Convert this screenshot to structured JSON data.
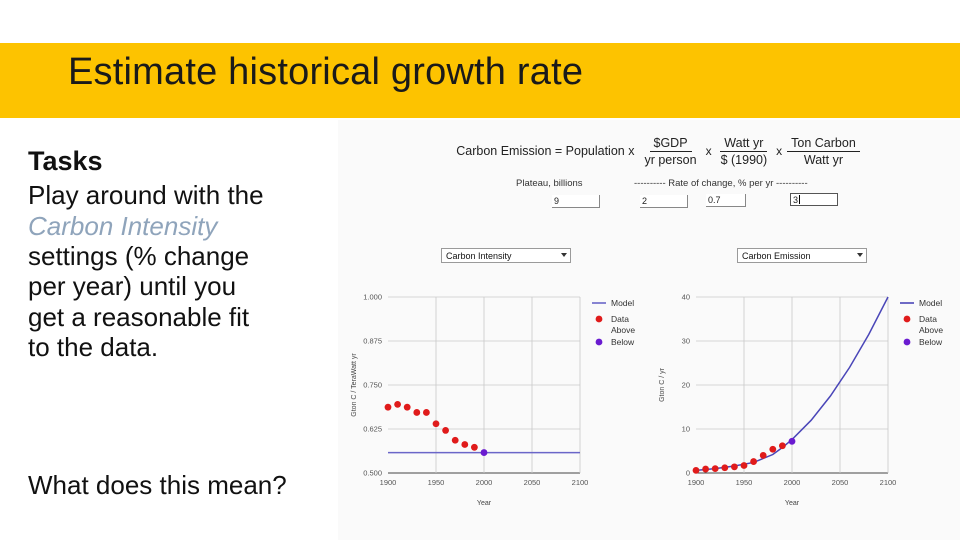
{
  "slide": {
    "title": "Estimate historical growth rate",
    "banner_color": "#fdc300"
  },
  "tasks": {
    "heading": "Tasks",
    "lines": [
      {
        "text": "Play around with the",
        "style": "normal"
      },
      {
        "text": "Carbon Intensity",
        "style": "italic-accent"
      },
      {
        "text": "settings (% change",
        "style": "normal"
      },
      {
        "text": "per year) until you",
        "style": "normal"
      },
      {
        "text": "get a reasonable fit",
        "style": "normal"
      },
      {
        "text": "to the data.",
        "style": "normal"
      }
    ],
    "question": "What does this mean?",
    "accent_color": "#8fa4bb"
  },
  "app": {
    "equation": {
      "lhs": "Carbon Emission = Population x",
      "times": "x",
      "terms": [
        {
          "numerator": "$GDP",
          "denominator": "yr  person"
        },
        {
          "numerator": "Watt yr",
          "denominator": "$ (1990)"
        },
        {
          "numerator": "Ton Carbon",
          "denominator": "Watt yr"
        }
      ]
    },
    "params": {
      "plateau_label": "Plateau, billions",
      "plateau_value": "9",
      "rate_label": "---------- Rate of change, % per yr ----------",
      "rate_population": "2",
      "rate_gdp": "0.7",
      "rate_intensity": "3"
    },
    "dropdowns": [
      {
        "name": "carbon-intensity-select",
        "value": "Carbon Intensity"
      },
      {
        "name": "carbon-emission-select",
        "value": "Carbon Emission"
      }
    ]
  },
  "chart_data": [
    {
      "type": "scatter",
      "id": "carbon-intensity",
      "title": "Carbon Intensity",
      "xlabel": "Year",
      "ylabel": "Gton C / TeraWatt yr",
      "xlim": [
        1900,
        2100
      ],
      "ylim": [
        0.5,
        1.0
      ],
      "xticks": [
        1900,
        1950,
        2000,
        2050,
        2100
      ],
      "yticks": [
        "0.500",
        "0.625",
        "0.750",
        "0.875",
        "1.000"
      ],
      "grid": true,
      "legend": [
        "Model",
        "Data",
        "Above",
        "Below"
      ],
      "legend_position": "right",
      "series": [
        {
          "name": "Model",
          "kind": "line",
          "color": "#6a66c8",
          "x": [
            1900,
            1950,
            2000,
            2050,
            2100
          ],
          "values": [
            0.558,
            0.558,
            0.558,
            0.558,
            0.558
          ]
        },
        {
          "name": "Data",
          "kind": "points",
          "color": "#e01b1b",
          "x": [
            1900,
            1910,
            1920,
            1930,
            1940,
            1950,
            1960,
            1970,
            1980,
            1990
          ],
          "values": [
            0.687,
            0.695,
            0.687,
            0.672,
            0.672,
            0.64,
            0.621,
            0.593,
            0.581,
            0.573
          ]
        },
        {
          "name": "Below",
          "kind": "points",
          "color": "#6a1bd0",
          "x": [
            2000
          ],
          "values": [
            0.558
          ]
        }
      ]
    },
    {
      "type": "line",
      "id": "carbon-emission",
      "title": "Carbon Emission",
      "xlabel": "Year",
      "ylabel": "Gton C / yr",
      "xlim": [
        1900,
        2100
      ],
      "ylim": [
        0,
        40
      ],
      "xticks": [
        1900,
        1950,
        2000,
        2050,
        2100
      ],
      "yticks": [
        "0",
        "10",
        "20",
        "30",
        "40"
      ],
      "grid": true,
      "legend": [
        "Model",
        "Data",
        "Above",
        "Below"
      ],
      "legend_position": "right",
      "series": [
        {
          "name": "Model",
          "kind": "line",
          "color": "#4a46b8",
          "x": [
            1900,
            1920,
            1940,
            1960,
            1980,
            1990,
            2000,
            2020,
            2040,
            2060,
            2080,
            2100
          ],
          "values": [
            0.6,
            1.0,
            1.6,
            2.4,
            4.2,
            5.8,
            7.6,
            12.0,
            17.5,
            24.0,
            31.5,
            40.0
          ]
        },
        {
          "name": "Data",
          "kind": "points",
          "color": "#e01b1b",
          "x": [
            1900,
            1910,
            1920,
            1930,
            1940,
            1950,
            1960,
            1970,
            1980,
            1990
          ],
          "values": [
            0.6,
            0.9,
            1.0,
            1.2,
            1.4,
            1.7,
            2.6,
            4.0,
            5.4,
            6.2
          ]
        },
        {
          "name": "Below",
          "kind": "points",
          "color": "#6a1bd0",
          "x": [
            2000
          ],
          "values": [
            7.2
          ]
        }
      ]
    }
  ]
}
